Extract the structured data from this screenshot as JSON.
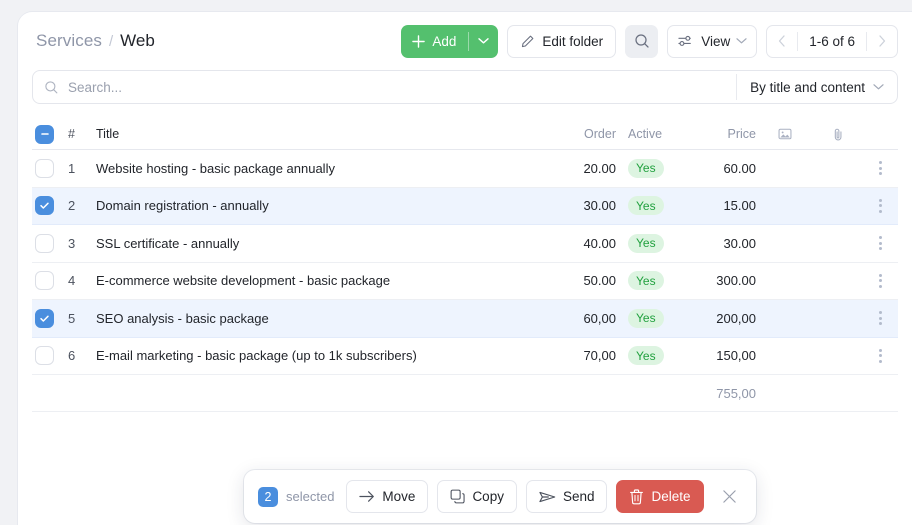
{
  "breadcrumb": {
    "parent": "Services",
    "separator": "/",
    "current": "Web"
  },
  "toolbar": {
    "add_label": "Add",
    "edit_folder_label": "Edit folder",
    "view_label": "View",
    "pagination_range": "1-6 of 6"
  },
  "search": {
    "placeholder": "Search...",
    "value": "",
    "scope_label": "By title and content"
  },
  "table": {
    "columns": {
      "num": "#",
      "title": "Title",
      "order": "Order",
      "active": "Active",
      "price": "Price"
    },
    "rows": [
      {
        "num": "1",
        "title": "Website hosting - basic package annually",
        "order": "20.00",
        "active": "Yes",
        "price": "60.00",
        "selected": false
      },
      {
        "num": "2",
        "title": "Domain registration - annually",
        "order": "30.00",
        "active": "Yes",
        "price": "15.00",
        "selected": true
      },
      {
        "num": "3",
        "title": "SSL certificate - annually",
        "order": "40.00",
        "active": "Yes",
        "price": "30.00",
        "selected": false
      },
      {
        "num": "4",
        "title": "E-commerce website development - basic package",
        "order": "50.00",
        "active": "Yes",
        "price": "300.00",
        "selected": false
      },
      {
        "num": "5",
        "title": "SEO analysis - basic package",
        "order": "60,00",
        "active": "Yes",
        "price": "200,00",
        "selected": true
      },
      {
        "num": "6",
        "title": "E-mail marketing - basic package (up to 1k subscribers)",
        "order": "70,00",
        "active": "Yes",
        "price": "150,00",
        "selected": false
      }
    ],
    "total_price": "755,00"
  },
  "action_bar": {
    "count": "2",
    "count_label": "selected",
    "move_label": "Move",
    "copy_label": "Copy",
    "send_label": "Send",
    "delete_label": "Delete"
  },
  "colors": {
    "add_green": "#54c06e",
    "checkbox_blue": "#4a8ede",
    "delete_red": "#d95a52",
    "pill_bg": "#ddf4e1",
    "pill_text": "#22a13f",
    "selected_row": "#eef4fe"
  }
}
